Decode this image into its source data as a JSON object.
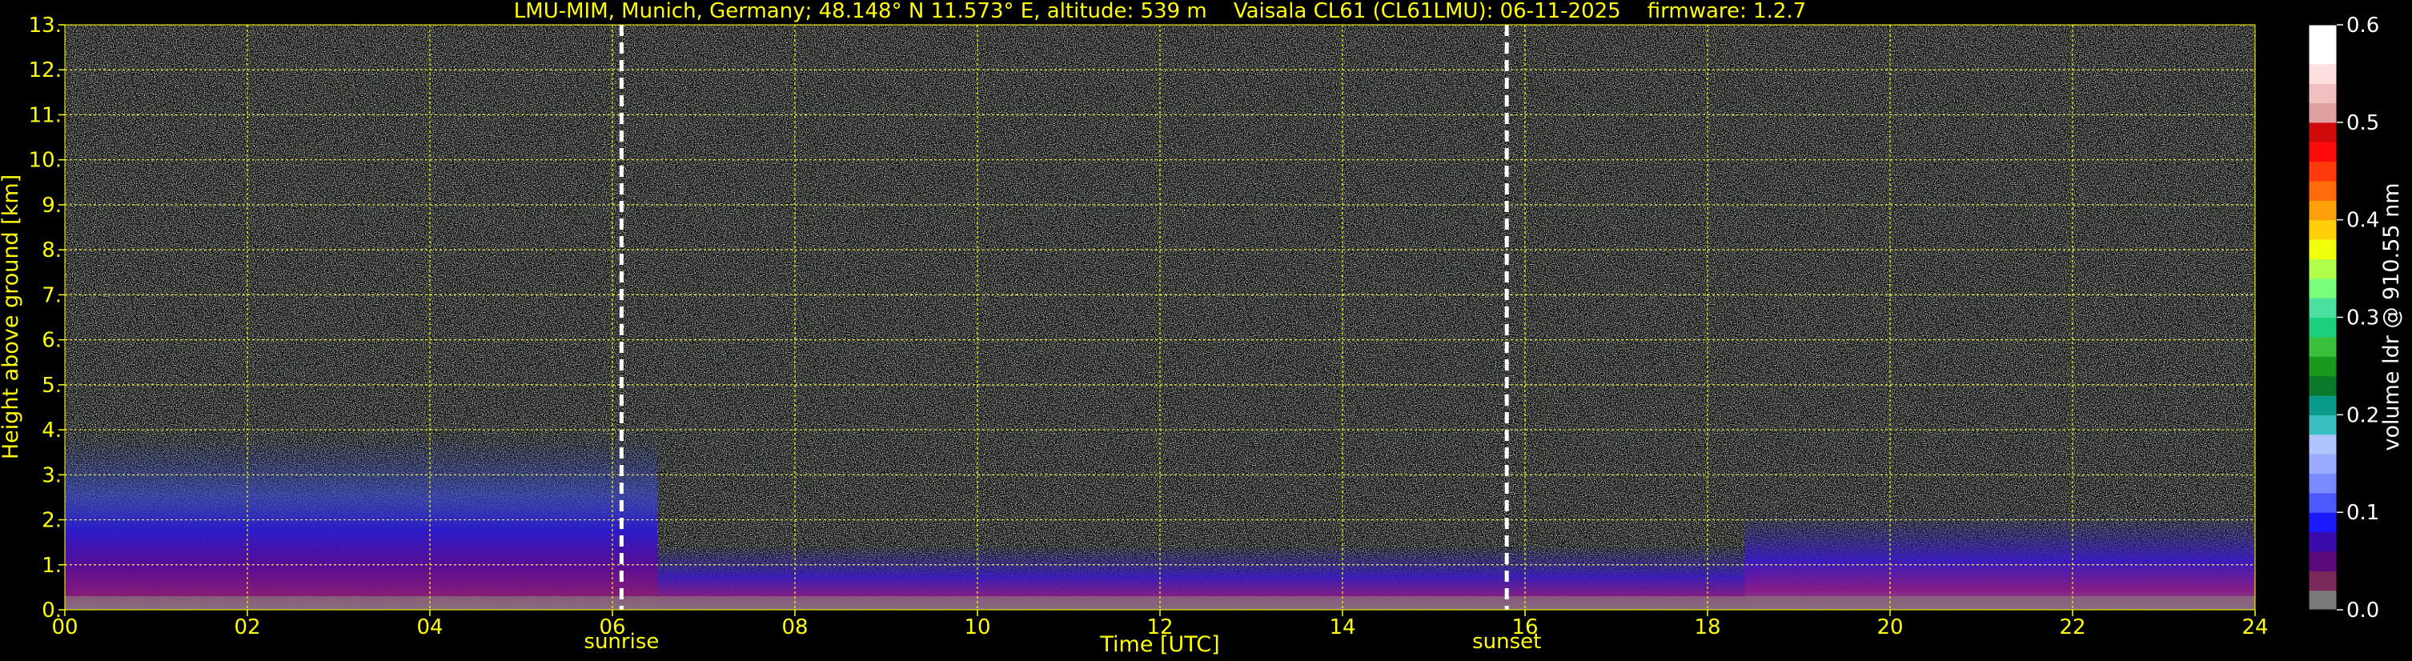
{
  "chart_data": {
    "type": "heatmap",
    "title": "LMU-MIM, Munich, Germany; 48.148° N 11.573° E, altitude: 539 m    Vaisala CL61 (CL61LMU): 06-11-2025    firmware: 1.2.7",
    "xlabel": "Time [UTC]",
    "ylabel": "Height above ground [km]",
    "xlim": [
      0,
      24
    ],
    "ylim": [
      0,
      13
    ],
    "x_ticks": [
      "00",
      "02",
      "04",
      "06",
      "08",
      "10",
      "12",
      "14",
      "16",
      "18",
      "20",
      "22",
      "24"
    ],
    "x_tick_values": [
      0,
      2,
      4,
      6,
      8,
      10,
      12,
      14,
      16,
      18,
      20,
      22,
      24
    ],
    "y_ticks": [
      "0.",
      "1.",
      "2.",
      "3.",
      "4.",
      "5.",
      "6.",
      "7.",
      "8.",
      "9.",
      "10.",
      "11.",
      "12.",
      "13."
    ],
    "y_tick_values": [
      0,
      1,
      2,
      3,
      4,
      5,
      6,
      7,
      8,
      9,
      10,
      11,
      12,
      13
    ],
    "grid": true,
    "colorbar": {
      "label": "volume ldr @ 910.55 nm",
      "range": [
        0,
        0.6
      ],
      "ticks": [
        "0.0",
        "0.1",
        "0.2",
        "0.3",
        "0.4",
        "0.5",
        "0.6"
      ],
      "tick_values": [
        0,
        0.1,
        0.2,
        0.3,
        0.4,
        0.5,
        0.6
      ],
      "colors": [
        "#7a7a7a",
        "#7a2a5a",
        "#5a0a7a",
        "#3a0aaa",
        "#1a1aff",
        "#4a5aff",
        "#7a8aff",
        "#9aaaff",
        "#b0c4ff",
        "#3ac0c0",
        "#0a9a8a",
        "#0a7a2a",
        "#1a9a1a",
        "#3ac03a",
        "#1ad07a",
        "#4ae0a0",
        "#7aff7a",
        "#b0ff4a",
        "#f0ff0a",
        "#ffd00a",
        "#ffa00a",
        "#ff6a0a",
        "#ff3a0a",
        "#ff0a0a",
        "#d00a0a",
        "#e0a0a0",
        "#f0c0c0",
        "#ffe0e0",
        "#ffffff",
        "#ffffff"
      ]
    },
    "annotations": [
      {
        "label": "sunrise",
        "x": 6.1
      },
      {
        "label": "sunset",
        "x": 15.8
      }
    ],
    "colors": {
      "text": "#ffff00",
      "grid": "#ffff00",
      "background": "#000000",
      "marker_line": "#ffffff"
    }
  }
}
